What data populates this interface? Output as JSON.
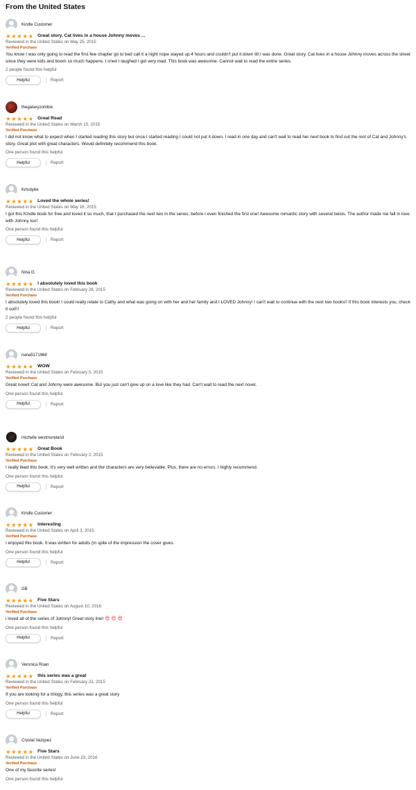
{
  "section_title": "From the United States",
  "ui": {
    "helpful_label": "Helpful",
    "report_label": "Report",
    "verified_label": "Verified Purchase"
  },
  "colors": {
    "star": "#f19e1b",
    "verified": "#c45500",
    "muted": "#565959"
  },
  "reviews": [
    {
      "user": "Kindle Customer",
      "avatar": "default-avatar-icon",
      "rating": 5,
      "title": "Great story. Cat lives in a house Johnny moves ...",
      "date": "Reviewed in the United States on May 25, 2015",
      "verified": true,
      "body": "You know I was only going to read the first few chapter go to bed call it a night nope stayed up 4 hours and couldn't put it down till I was done. Great story. Cat lives in a house Johnny moves across the street since they were kids and boom so much happens. I cried I laughed I got very mad. This book was awesome. Cannot wait to read the entire series.",
      "helpful": "2 people found this helpful"
    },
    {
      "user": "thegalaxyzombie",
      "avatar": "photo-avatar-icon",
      "rating": 5,
      "title": "Great Read",
      "date": "Reviewed in the United States on March 15, 2015",
      "verified": true,
      "body": "I did not know what to expect when I started reading this story but once I started reading I could not put it down. I read in one day and can't wait to read her next book to find out the rest of Cat and Johnny's story. Great plot with great characters. Would definitely recommend this book.",
      "helpful": "One person found this helpful"
    },
    {
      "user": "Krhrdy64",
      "avatar": "default-avatar-icon",
      "rating": 5,
      "title": "Loved the whole series!",
      "date": "Reviewed in the United States on May 16, 2015",
      "verified": false,
      "body": "I got this Kindle book for free and loved it so much, that I purchased the next two in the series, before I even finished the first one! Awesome romantic story with several twists. The author made me fall in love with Johnny too!",
      "helpful": "One person found this helpful"
    },
    {
      "user": "Nina G.",
      "avatar": "default-avatar-icon",
      "rating": 5,
      "title": "I absolutely loved this book",
      "date": "Reviewed in the United States on February 28, 2015",
      "verified": true,
      "body": "I absolutely loved this book! I could really relate to Cathy and what was going on with her and her family and I LOVED Johnny! I can't wait to continue with the next two books!! If this book interests you, check it out!!!",
      "helpful": "2 people found this helpful"
    },
    {
      "user": "nana5171968",
      "avatar": "default-avatar-icon",
      "rating": 5,
      "title": "WOW",
      "date": "Reviewed in the United States on February 5, 2015",
      "verified": true,
      "body": "Great novel! Cat and Johnny were awesome. But you just can't give up on a love like they had. Can't wait to read the next novel.",
      "helpful": "One person found this helpful"
    },
    {
      "user": "michelle westmoreland",
      "avatar": "photo-avatar-icon",
      "rating": 5,
      "title": "Great Book",
      "date": "Reviewed in the United States on February 2, 2015",
      "verified": true,
      "body": "I really liked this book. It's very well written and the characters are very believable. Plus, there are no errors. I highly recommend.",
      "helpful": "One person found this helpful"
    },
    {
      "user": "Kindle Customer",
      "avatar": "default-avatar-icon",
      "rating": 5,
      "title": "Interesting",
      "date": "Reviewed in the United States on April 3, 2015",
      "verified": true,
      "body": "I enjoyed this book. It was written for adults (in spite of the impression the cover gives.",
      "helpful": "One person found this helpful"
    },
    {
      "user": "GB",
      "avatar": "default-avatar-icon",
      "rating": 5,
      "title": "Five Stars",
      "date": "Reviewed in the United States on August 10, 2016",
      "verified": true,
      "body": "i loved all of the series of Johnny! Great story line!",
      "emoji": "😍 😍 😍",
      "helpful": "One person found this helpful"
    },
    {
      "user": "Veronica Roan",
      "avatar": "default-avatar-icon",
      "rating": 5,
      "title": "this series was a great",
      "date": "Reviewed in the United States on February 23, 2015",
      "verified": true,
      "body": "If you are looking for a trilogy, this series was a great story",
      "helpful": "One person found this helpful"
    },
    {
      "user": "Crystal Vazquez",
      "avatar": "default-avatar-icon",
      "rating": 5,
      "title": "Five Stars",
      "date": "Reviewed in the United States on June 23, 2016",
      "verified": true,
      "body": "One of my favorite series!",
      "helpful": "One person found this helpful"
    }
  ]
}
